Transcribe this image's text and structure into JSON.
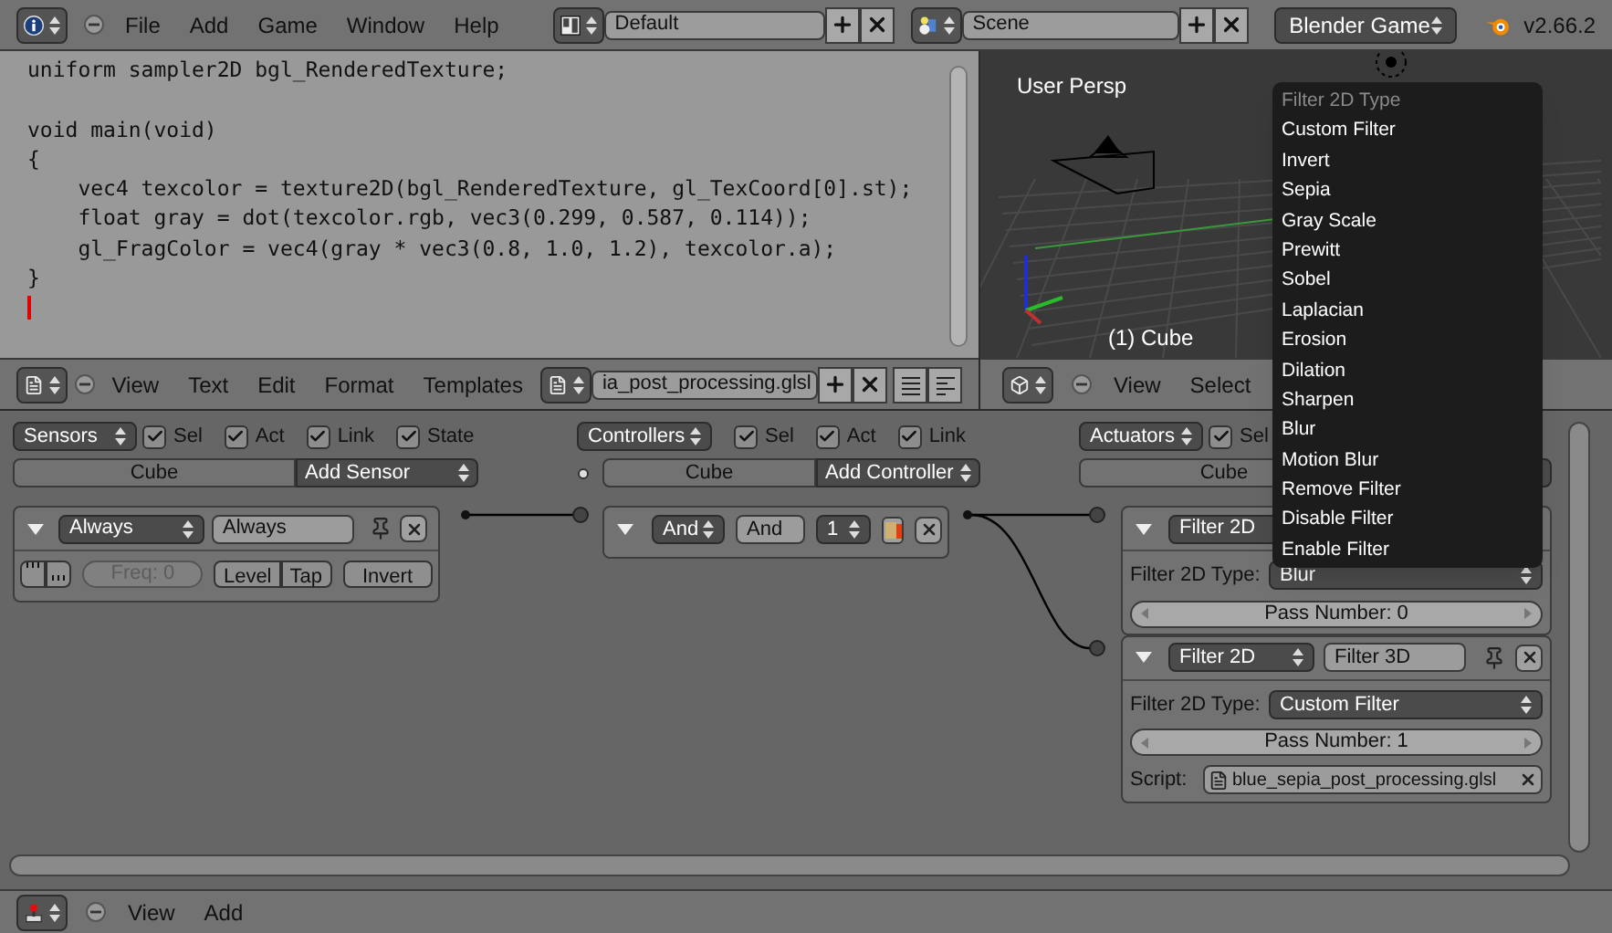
{
  "info_header": {
    "menus": [
      "File",
      "Add",
      "Game",
      "Window",
      "Help"
    ],
    "screen": "Default",
    "scene": "Scene",
    "engine": "Blender Game",
    "version": "v2.66.2"
  },
  "text_editor": {
    "blocks": [
      {
        "lines": [
          "uniform sampler2D bgl_RenderedTexture;"
        ]
      },
      {
        "lines": [
          "void main(void)",
          "{",
          "    vec4 texcolor = texture2D(bgl_RenderedTexture, gl_TexCoord[0].st);",
          "    float gray = dot(texcolor.rgb, vec3(0.299, 0.587, 0.114));",
          "    gl_FragColor = vec4(gray * vec3(0.8, 1.0, 1.2), texcolor.a);",
          "}"
        ]
      }
    ],
    "header": {
      "menus": [
        "View",
        "Text",
        "Edit",
        "Format",
        "Templates"
      ],
      "file": "ia_post_processing.glsl"
    }
  },
  "viewport": {
    "label": "User Persp",
    "object": "(1) Cube",
    "header": {
      "menus": [
        "View",
        "Select"
      ]
    }
  },
  "logic": {
    "sensors": {
      "dropdown": "Sensors",
      "filters": [
        {
          "label": "Sel",
          "checked": true
        },
        {
          "label": "Act",
          "checked": true
        },
        {
          "label": "Link",
          "checked": true
        },
        {
          "label": "State",
          "checked": true
        }
      ],
      "object": "Cube",
      "add": "Add Sensor",
      "bricks": [
        {
          "expanded": true,
          "type": "Always",
          "name": "Always",
          "freq": "Freq: 0",
          "toggles": [
            "Level",
            "Tap"
          ],
          "invert": "Invert"
        }
      ]
    },
    "controllers": {
      "dropdown": "Controllers",
      "filters": [
        {
          "label": "Sel",
          "checked": true
        },
        {
          "label": "Act",
          "checked": true
        },
        {
          "label": "Link",
          "checked": true
        }
      ],
      "object": "Cube",
      "add": "Add Controller",
      "bricks": [
        {
          "expanded": true,
          "type": "And",
          "name": "And",
          "state": "1"
        }
      ]
    },
    "actuators": {
      "dropdown": "Actuators",
      "filters": [
        {
          "label": "Sel",
          "checked": true
        }
      ],
      "object": "Cube",
      "bricks": [
        {
          "expanded": true,
          "type": "Filter 2D",
          "type_label": "Filter 2D Type:",
          "filter": "Blur",
          "pass": "Pass Number: 0"
        },
        {
          "expanded": true,
          "type": "Filter 2D",
          "name": "Filter 3D",
          "type_label": "Filter 2D Type:",
          "filter": "Custom Filter",
          "pass": "Pass Number: 1",
          "script_label": "Script:",
          "script": "blue_sepia_post_processing.glsl"
        }
      ]
    }
  },
  "popup": {
    "title": "Filter 2D Type",
    "items": [
      "Custom Filter",
      "Invert",
      "Sepia",
      "Gray Scale",
      "Prewitt",
      "Sobel",
      "Laplacian",
      "Erosion",
      "Dilation",
      "Sharpen",
      "Blur",
      "Motion Blur",
      "Remove Filter",
      "Disable Filter",
      "Enable Filter"
    ]
  },
  "bottom_header": {
    "menus": [
      "View",
      "Add"
    ]
  }
}
